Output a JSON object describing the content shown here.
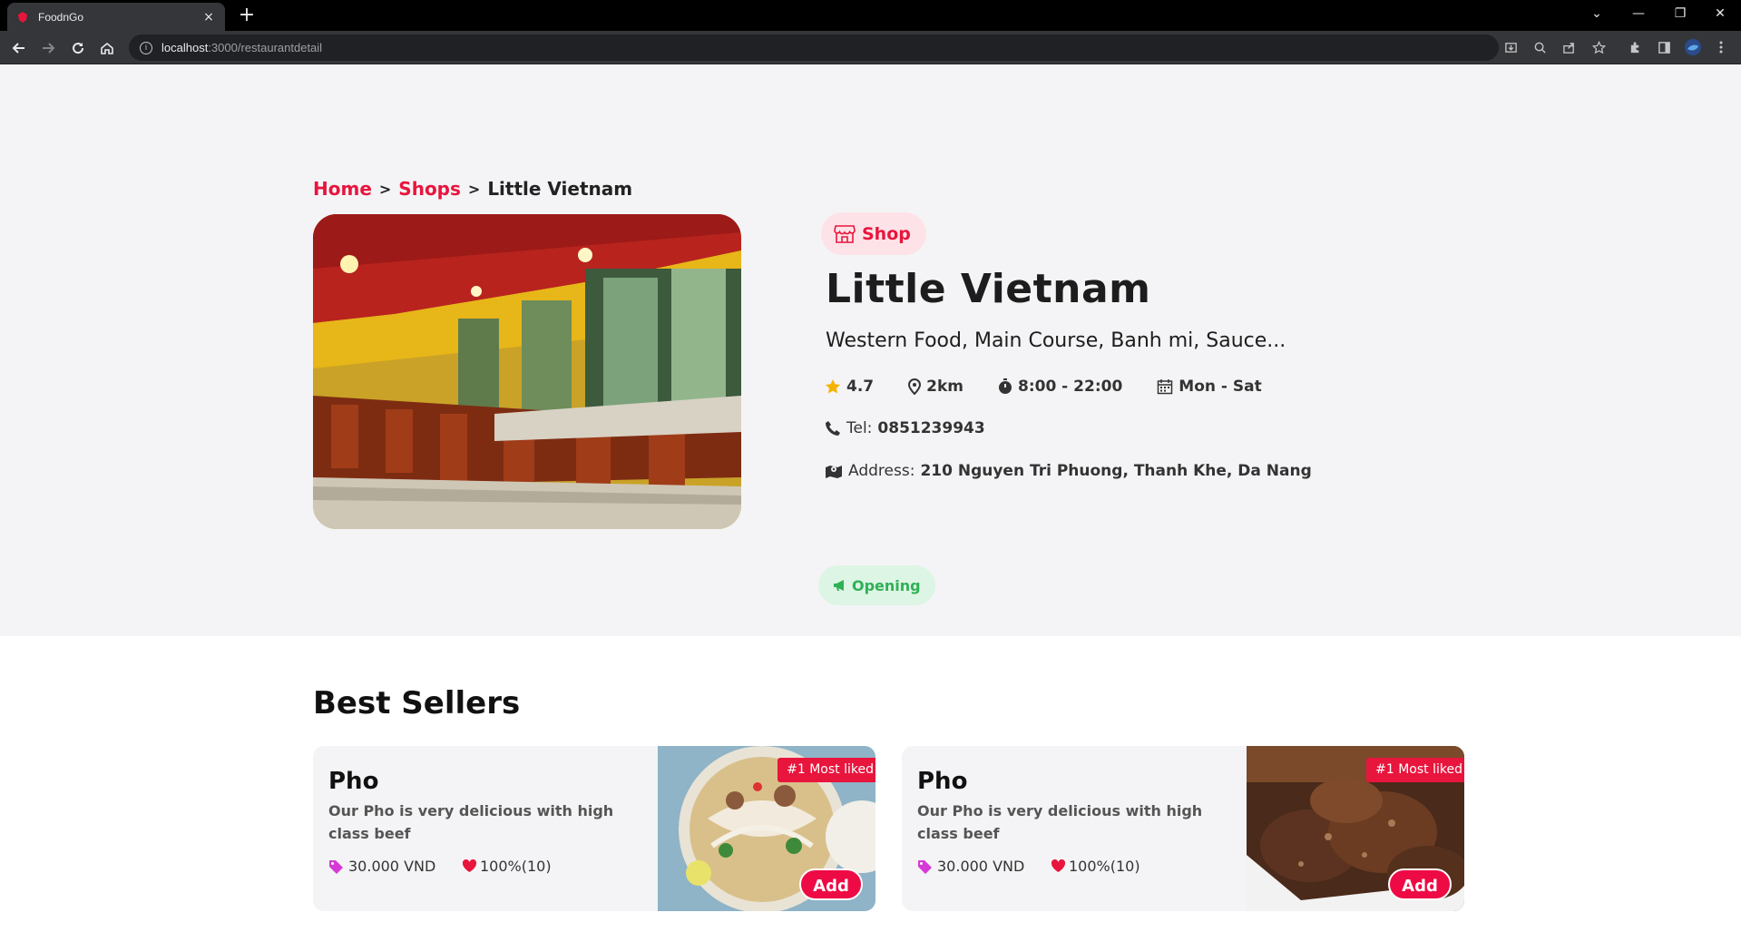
{
  "browser": {
    "tab_title": "FoodnGo",
    "tab_close": "×",
    "new_tab": "+",
    "url_host": "localhost",
    "url_path": ":3000/restaurantdetail"
  },
  "breadcrumb": {
    "home": "Home",
    "shops": "Shops",
    "current": "Little Vietnam",
    "separator": ">"
  },
  "restaurant": {
    "badge": "Shop",
    "name": "Little Vietnam",
    "categories": "Western Food, Main Course, Banh mi, Sauce...",
    "rating": "4.7",
    "distance": "2km",
    "hours": "8:00 - 22:00",
    "days": "Mon - Sat",
    "tel_label": "Tel:",
    "tel": "0851239943",
    "address_label": "Address:",
    "address": "210 Nguyen Tri Phuong, Thanh Khe, Da Nang",
    "status": "Opening"
  },
  "best_sellers": {
    "title": "Best Sellers",
    "items": [
      {
        "name": "Pho",
        "description": "Our Pho is very delicious with high class beef",
        "price": "30.000 VND",
        "likes": "100%(10)",
        "tag": "#1 Most liked",
        "add_label": "Add"
      },
      {
        "name": "Pho",
        "description": "Our Pho is very delicious with high class beef",
        "price": "30.000 VND",
        "likes": "100%(10)",
        "tag": "#1 Most liked",
        "add_label": "Add"
      }
    ]
  },
  "colors": {
    "accent": "#e8153d",
    "open_green": "#2fb157",
    "star": "#f5b301",
    "price_tag": "#d63ad6"
  }
}
